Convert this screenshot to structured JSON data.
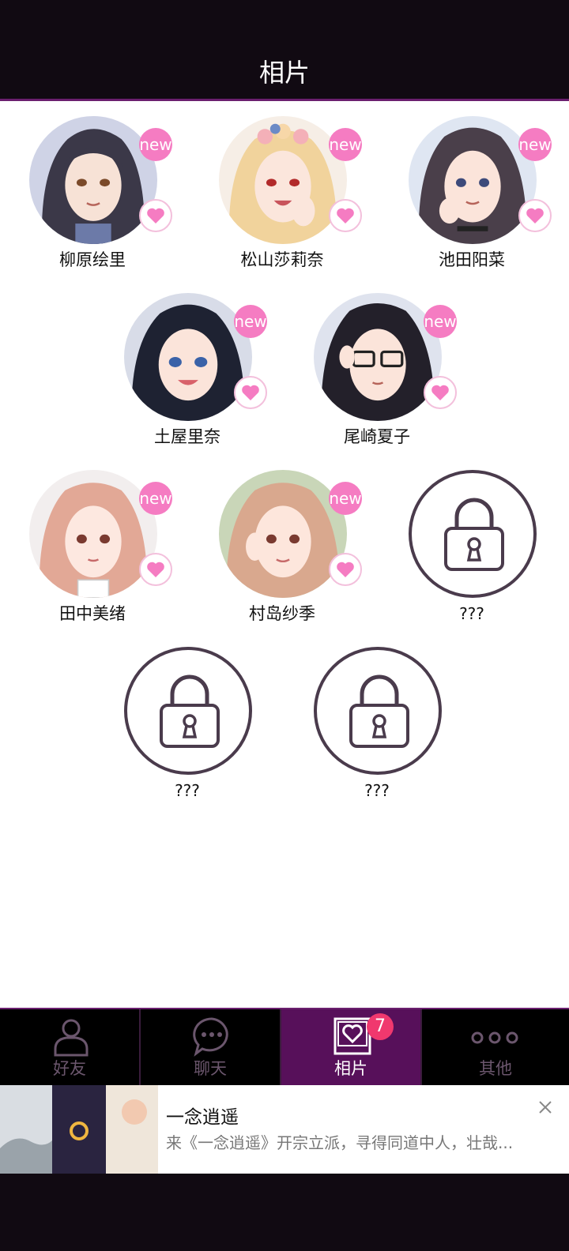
{
  "header": {
    "title": "相片"
  },
  "grid": {
    "cards": [
      {
        "name": "柳原绘里",
        "badge_new": "new",
        "locked": false
      },
      {
        "name": "松山莎莉奈",
        "badge_new": "new",
        "locked": false
      },
      {
        "name": "池田阳菜",
        "badge_new": "new",
        "locked": false
      },
      {
        "name": "土屋里奈",
        "badge_new": "new",
        "locked": false
      },
      {
        "name": "尾崎夏子",
        "badge_new": "new",
        "locked": false
      },
      {
        "name": "田中美绪",
        "badge_new": "new",
        "locked": false
      },
      {
        "name": "村岛纱季",
        "badge_new": "new",
        "locked": false
      },
      {
        "name": "???",
        "locked": true
      },
      {
        "name": "???",
        "locked": true
      },
      {
        "name": "???",
        "locked": true
      }
    ]
  },
  "tabs": [
    {
      "label": "好友",
      "icon": "person-icon",
      "active": false
    },
    {
      "label": "聊天",
      "icon": "chat-bubble-icon",
      "active": false
    },
    {
      "label": "相片",
      "icon": "photo-heart-icon",
      "active": true,
      "badge": "7"
    },
    {
      "label": "其他",
      "icon": "more-dots-icon",
      "active": false
    }
  ],
  "ad": {
    "title": "一念逍遥",
    "description": "来《一念逍遥》开宗立派，寻得同道中人，壮哉...",
    "close_icon": "close-icon"
  },
  "colors": {
    "header_bg": "#110a12",
    "accent_purple": "#57105a",
    "badge_pink": "#f57cc2",
    "tab_badge_red": "#f0386e"
  }
}
